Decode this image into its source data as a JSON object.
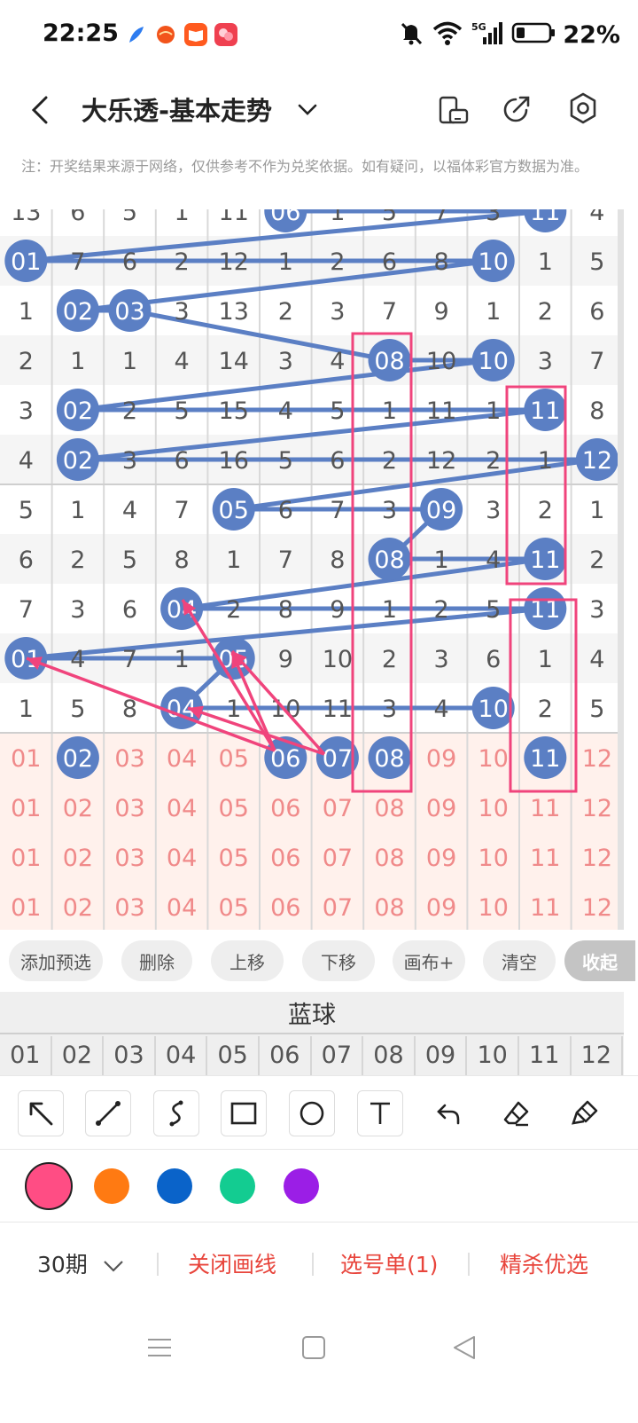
{
  "status": {
    "time": "22:25",
    "battery": "22%",
    "network": "5G"
  },
  "header": {
    "title": "大乐透-基本走势"
  },
  "disclaimer": "注：开奖结果来源于网络，仅供参考不作为兑奖依据。如有疑问，以福体彩官方数据为准。",
  "grid": {
    "rows": [
      [
        "13",
        "6",
        "5",
        "1",
        "11",
        "06",
        "1",
        "5",
        "7",
        "3",
        "11",
        "4"
      ],
      [
        "01",
        "7",
        "6",
        "2",
        "12",
        "1",
        "2",
        "6",
        "8",
        "10",
        "1",
        "5"
      ],
      [
        "1",
        "02",
        "03",
        "3",
        "13",
        "2",
        "3",
        "7",
        "9",
        "1",
        "2",
        "6"
      ],
      [
        "2",
        "1",
        "1",
        "4",
        "14",
        "3",
        "4",
        "08",
        "10",
        "10",
        "3",
        "7"
      ],
      [
        "3",
        "02",
        "2",
        "5",
        "15",
        "4",
        "5",
        "1",
        "11",
        "1",
        "11",
        "8"
      ],
      [
        "4",
        "02",
        "3",
        "6",
        "16",
        "5",
        "6",
        "2",
        "12",
        "2",
        "1",
        "12"
      ],
      [
        "5",
        "1",
        "4",
        "7",
        "05",
        "6",
        "7",
        "3",
        "09",
        "3",
        "2",
        "1"
      ],
      [
        "6",
        "2",
        "5",
        "8",
        "1",
        "7",
        "8",
        "08",
        "1",
        "4",
        "11",
        "2"
      ],
      [
        "7",
        "3",
        "6",
        "04",
        "2",
        "8",
        "9",
        "1",
        "2",
        "5",
        "11",
        "3"
      ],
      [
        "01",
        "4",
        "7",
        "1",
        "05",
        "9",
        "10",
        "2",
        "3",
        "6",
        "1",
        "4"
      ],
      [
        "1",
        "5",
        "8",
        "04",
        "1",
        "10",
        "11",
        "3",
        "4",
        "10",
        "2",
        "5"
      ]
    ],
    "hits": [
      [
        0,
        5
      ],
      [
        0,
        10
      ],
      [
        1,
        0
      ],
      [
        1,
        9
      ],
      [
        2,
        1
      ],
      [
        2,
        2
      ],
      [
        3,
        7
      ],
      [
        3,
        9
      ],
      [
        4,
        1
      ],
      [
        4,
        10
      ],
      [
        5,
        1
      ],
      [
        5,
        11
      ],
      [
        6,
        4
      ],
      [
        6,
        8
      ],
      [
        7,
        7
      ],
      [
        7,
        10
      ],
      [
        8,
        3
      ],
      [
        8,
        10
      ],
      [
        9,
        0
      ],
      [
        9,
        4
      ],
      [
        10,
        3
      ],
      [
        10,
        9
      ]
    ],
    "selection_rows": [
      [
        "01",
        "02",
        "03",
        "04",
        "05",
        "06",
        "07",
        "08",
        "09",
        "10",
        "11",
        "12"
      ],
      [
        "01",
        "02",
        "03",
        "04",
        "05",
        "06",
        "07",
        "08",
        "09",
        "10",
        "11",
        "12"
      ],
      [
        "01",
        "02",
        "03",
        "04",
        "05",
        "06",
        "07",
        "08",
        "09",
        "10",
        "11",
        "12"
      ],
      [
        "01",
        "02",
        "03",
        "04",
        "05",
        "06",
        "07",
        "08",
        "09",
        "10",
        "11",
        "12"
      ]
    ],
    "selected": [
      1,
      5,
      6,
      7,
      10
    ]
  },
  "actions": {
    "add": "添加预选",
    "delete": "删除",
    "up": "上移",
    "down": "下移",
    "canvas": "画布+",
    "clear": "清空",
    "collapse": "收起"
  },
  "blue": {
    "title": "蓝球",
    "numbers": [
      "01",
      "02",
      "03",
      "04",
      "05",
      "06",
      "07",
      "08",
      "09",
      "10",
      "11",
      "12"
    ]
  },
  "tools": {
    "icons": [
      "arrow-tool-icon",
      "line-tool-icon",
      "curve-tool-icon",
      "rect-tool-icon",
      "circle-tool-icon",
      "text-tool-icon",
      "undo-icon",
      "eraser-icon",
      "brush-icon"
    ]
  },
  "palette": {
    "colors": [
      "#ff4d84",
      "#ff7a12",
      "#0a63c9",
      "#13cc91",
      "#9b1ee6"
    ]
  },
  "bottom": {
    "period": "30期",
    "close_draw": "关闭画线",
    "ticket": "选号单(1)",
    "optimize": "精杀优选"
  },
  "theme": {
    "ball": "#5b7fc4",
    "pink": "#f0447c",
    "accent_red": "#e8453c"
  }
}
